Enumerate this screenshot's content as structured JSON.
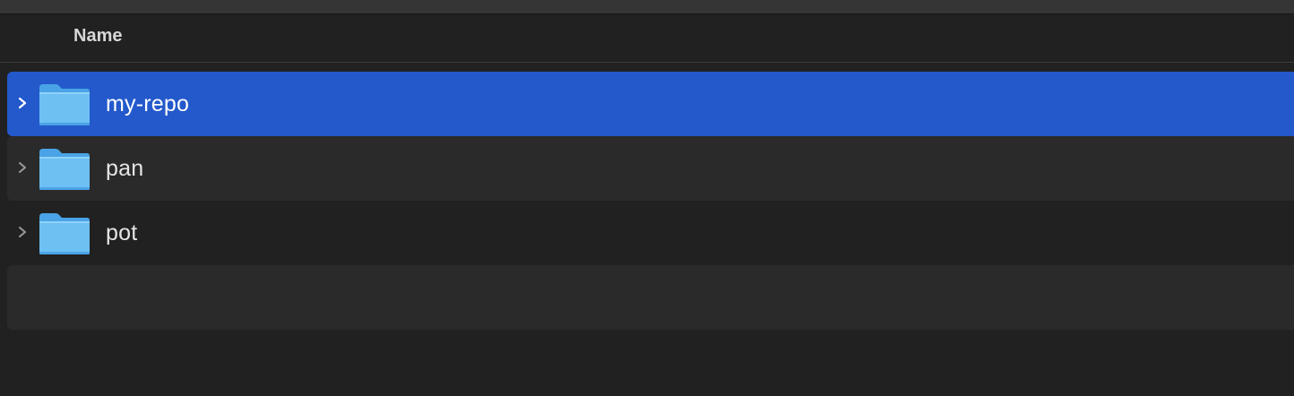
{
  "columns": {
    "name": "Name"
  },
  "icons": {
    "expand": "chevron-right-icon",
    "folder": "folder-icon"
  },
  "colors": {
    "selection": "#2359cb",
    "folder": "#6ec0f3"
  },
  "rows": [
    {
      "label": "my-repo",
      "selected": true
    },
    {
      "label": "pan",
      "selected": false
    },
    {
      "label": "pot",
      "selected": false
    }
  ]
}
